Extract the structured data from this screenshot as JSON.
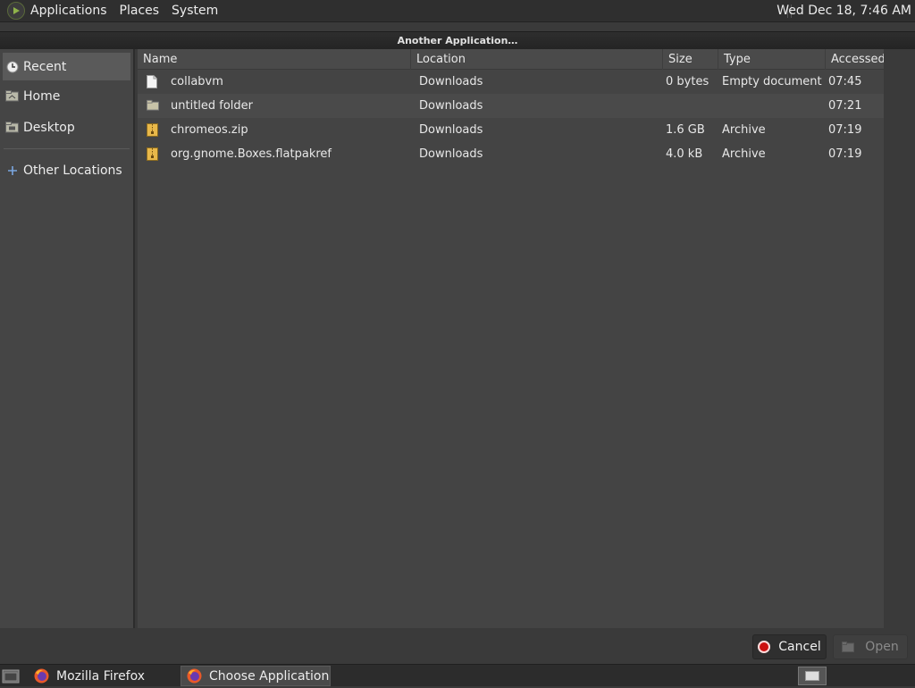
{
  "top_panel": {
    "menus": [
      "Applications",
      "Places",
      "System"
    ],
    "clock": "Wed Dec 18,  7:46 AM"
  },
  "window": {
    "title": "Another Application…"
  },
  "sidebar": {
    "items": [
      {
        "label": "Recent",
        "icon": "clock-icon",
        "selected": true
      },
      {
        "label": "Home",
        "icon": "home-folder-icon"
      },
      {
        "label": "Desktop",
        "icon": "desktop-folder-icon"
      }
    ],
    "other": {
      "label": "Other Locations",
      "icon": "plus-icon"
    }
  },
  "file_list": {
    "columns": [
      "Name",
      "Location",
      "Size",
      "Type",
      "Accessed"
    ],
    "rows": [
      {
        "name": "collabvm",
        "location": "Downloads",
        "size": "0 bytes",
        "type": "Empty document",
        "accessed": "07:45",
        "icon": "document-icon"
      },
      {
        "name": "untitled folder",
        "location": "Downloads",
        "size": "",
        "type": "",
        "accessed": "07:21",
        "icon": "folder-icon"
      },
      {
        "name": "chromeos.zip",
        "location": "Downloads",
        "size": "1.6 GB",
        "type": "Archive",
        "accessed": "07:19",
        "icon": "archive-icon"
      },
      {
        "name": "org.gnome.Boxes.flatpakref",
        "location": "Downloads",
        "size": "4.0 kB",
        "type": "Archive",
        "accessed": "07:19",
        "icon": "archive-icon"
      }
    ]
  },
  "buttons": {
    "cancel": "Cancel",
    "open": "Open"
  },
  "taskbar": {
    "tasks": [
      "Mozilla Firefox",
      "Choose Application"
    ]
  }
}
